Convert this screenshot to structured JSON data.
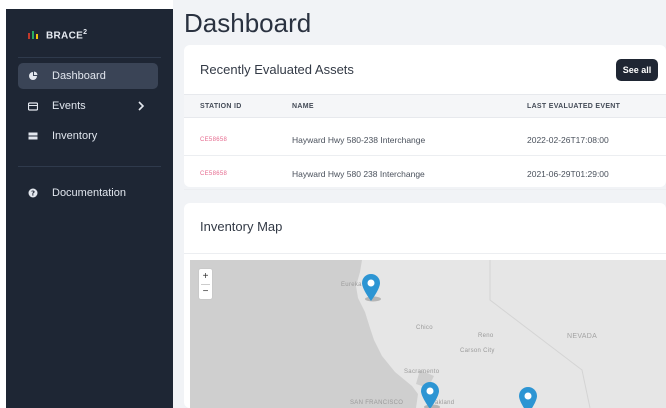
{
  "sidebar": {
    "brand": "BRACE",
    "brand_sup": "2",
    "brand_colors": [
      "#c0392b",
      "#27ae60",
      "#f1c40f"
    ],
    "items": [
      {
        "label": "Dashboard",
        "icon": "dashboard-icon",
        "active": true
      },
      {
        "label": "Events",
        "icon": "events-icon",
        "active": false,
        "has_children": true
      },
      {
        "label": "Inventory",
        "icon": "inventory-icon",
        "active": false
      }
    ],
    "secondary": [
      {
        "label": "Documentation",
        "icon": "help-circle-icon"
      }
    ]
  },
  "main": {
    "title": "Dashboard",
    "assets_card": {
      "title": "Recently Evaluated Assets",
      "see_all_label": "See all",
      "columns": [
        "STATION ID",
        "NAME",
        "LAST EVALUATED EVENT"
      ],
      "rows": [
        {
          "station_id": "CE58658",
          "name": "Hayward Hwy 580-238 Interchange",
          "last_event": "2022-02-26T17:08:00"
        },
        {
          "station_id": "CE58658",
          "name": "Hayward Hwy 580 238 Interchange",
          "last_event": "2021-06-29T01:29:00"
        }
      ]
    },
    "map_card": {
      "title": "Inventory Map",
      "zoom_in": "+",
      "zoom_out": "−",
      "labels": {
        "eureka": "Eureka",
        "chico": "Chico",
        "reno": "Reno",
        "carson": "Carson City",
        "nevada": "NEVADA",
        "sacramento": "Sacramento",
        "sanfrancisco": "SAN FRANCISCO",
        "oakland": "Oakland"
      },
      "pin_color": "#2d95d3",
      "land_color": "#e6e6e6",
      "water_color": "#cfcfcf"
    }
  },
  "colors": {
    "sidebar_bg": "#1e2634",
    "accent_link": "#e66b8f",
    "button_dark": "#1f2633"
  }
}
